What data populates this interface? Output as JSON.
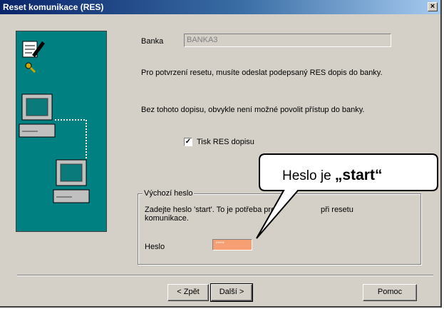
{
  "window": {
    "title": "Reset komunikace (RES)",
    "close": "×"
  },
  "form": {
    "bank_label": "Banka",
    "bank_value": "BANKA3",
    "text1": "Pro potvrzení resetu, musíte odeslat podepsaný RES dopis do banky.",
    "text2": "Bez tohoto dopisu, obvykle není možné povolit přístup do banky.",
    "checkbox_label": "Tisk RES dopisu",
    "checkbox_mark": "✓",
    "group_title": "Výchozí heslo",
    "group_text_a": "Zadejte heslo 'start'. To je potřeba pro",
    "group_text_b": "při resetu",
    "group_text_c": "komunikace.",
    "password_label": "Heslo",
    "password_mask": "*****"
  },
  "buttons": {
    "back": "< Zpět",
    "next": "Další >",
    "help": "Pomoc"
  },
  "callout": {
    "prefix": "Heslo je ",
    "emphasis": "„start“"
  },
  "colors": {
    "panel": "#008080",
    "password_bg": "#f59f72",
    "title_start": "#0a246a"
  }
}
